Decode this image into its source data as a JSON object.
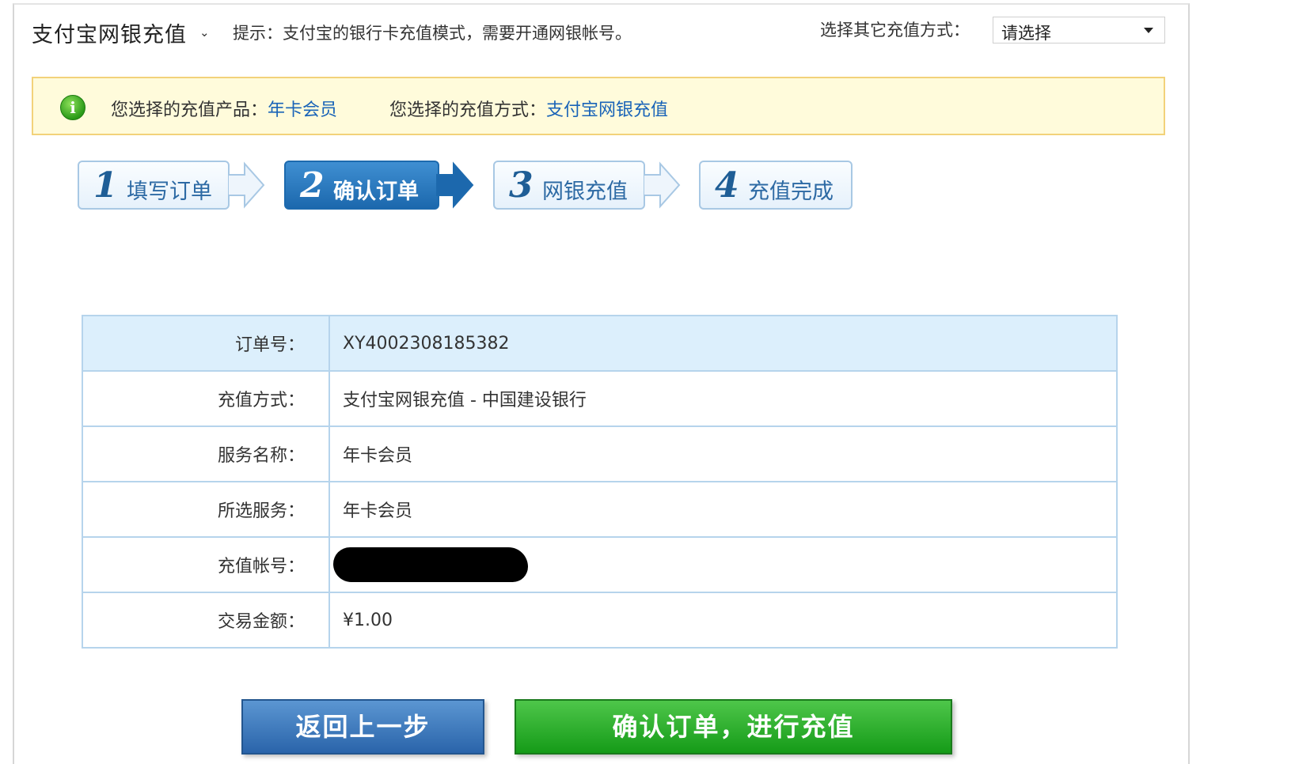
{
  "header": {
    "title": "支付宝网银充值",
    "title_chevron": "⌄",
    "tip": "提示：支付宝的银行卡充值模式，需要开通网银帐号。",
    "other_label": "选择其它充值方式：",
    "select_value": "请选择"
  },
  "info": {
    "icon": "info-icon",
    "product_label": "您选择的充值产品：",
    "product_value": "年卡会员",
    "method_label": "您选择的充值方式：",
    "method_value": "支付宝网银充值"
  },
  "steps": [
    {
      "num": "1",
      "label": "填写订单",
      "active": false
    },
    {
      "num": "2",
      "label": "确认订单",
      "active": true
    },
    {
      "num": "3",
      "label": "网银充值",
      "active": false
    },
    {
      "num": "4",
      "label": "充值完成",
      "active": false
    }
  ],
  "order": {
    "rows": [
      {
        "key": "订单号：",
        "value": "XY4002308185382"
      },
      {
        "key": "充值方式：",
        "value": "支付宝网银充值 - 中国建设银行"
      },
      {
        "key": "服务名称：",
        "value": "年卡会员"
      },
      {
        "key": "所选服务：",
        "value": "年卡会员"
      },
      {
        "key": "充值帐号：",
        "value": ""
      },
      {
        "key": "交易金额：",
        "value": "¥1.00"
      }
    ]
  },
  "buttons": {
    "back": "返回上一步",
    "confirm": "确认订单，进行充值"
  },
  "colors": {
    "link": "#1a64b8",
    "step_active": "#1c68ad",
    "confirm_green": "#159b18",
    "back_blue": "#2a64aa"
  }
}
